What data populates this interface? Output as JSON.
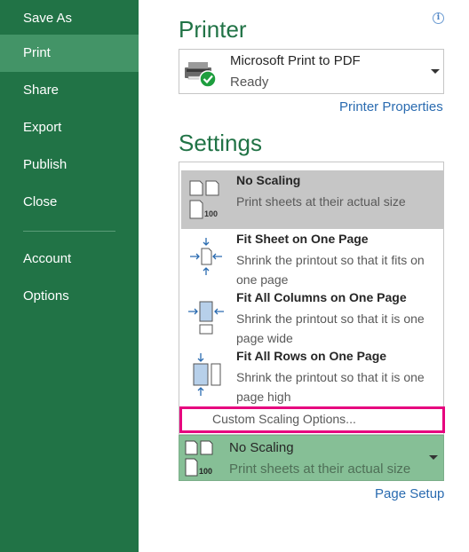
{
  "sidebar": {
    "items": [
      {
        "label": "Save As"
      },
      {
        "label": "Print"
      },
      {
        "label": "Share"
      },
      {
        "label": "Export"
      },
      {
        "label": "Publish"
      },
      {
        "label": "Close"
      },
      {
        "label": "Account"
      },
      {
        "label": "Options"
      }
    ],
    "active_item": "Print"
  },
  "printer": {
    "heading": "Printer",
    "name": "Microsoft Print to PDF",
    "status": "Ready",
    "properties_link": "Printer Properties",
    "info_icon": "i"
  },
  "settings": {
    "heading": "Settings",
    "scaling_options": [
      {
        "title": "No Scaling",
        "description": "Print sheets at their actual size",
        "icon": "no-scaling-icon",
        "icon_text": "100",
        "selected": true
      },
      {
        "title": "Fit Sheet on One Page",
        "description": "Shrink the printout so that it fits on one page",
        "icon": "fit-sheet-icon",
        "selected": false
      },
      {
        "title": "Fit All Columns on One Page",
        "description": "Shrink the printout so that it is one page wide",
        "icon": "fit-columns-icon",
        "selected": false
      },
      {
        "title": "Fit All Rows on One Page",
        "description": "Shrink the printout so that it is one page high",
        "icon": "fit-rows-icon",
        "selected": false
      }
    ],
    "custom_option_label": "Custom Scaling Options...",
    "current_scaling": {
      "title": "No Scaling",
      "description": "Print sheets at their actual size",
      "icon_text": "100"
    },
    "page_setup_link": "Page Setup"
  },
  "colors": {
    "sidebar_bg": "#217346",
    "sidebar_active": "#439467",
    "heading_green": "#217346",
    "link_blue": "#2a6bb0",
    "highlight_border": "#e6007e",
    "selected_option_bg": "#c6c6c6",
    "current_selection_bg": "#86bf96"
  }
}
